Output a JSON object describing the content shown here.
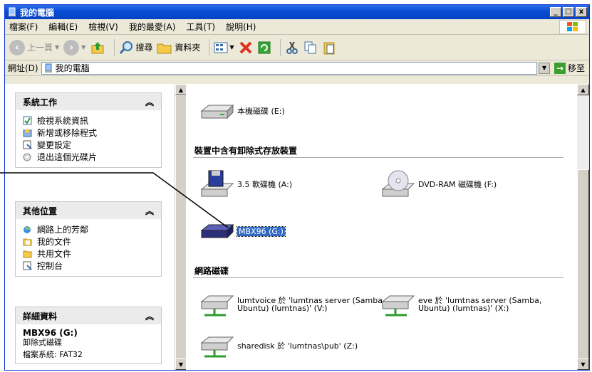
{
  "window": {
    "title": "我的電腦",
    "min_label": "_",
    "max_label": "□",
    "close_label": "x"
  },
  "menu": [
    "檔案(F)",
    "編輯(E)",
    "檢視(V)",
    "我的最愛(A)",
    "工具(T)",
    "說明(H)"
  ],
  "toolbar": {
    "back": "上一頁",
    "search": "搜尋",
    "folders": "資料夾"
  },
  "address": {
    "label": "網址(D)",
    "value": "我的電腦",
    "go": "移至"
  },
  "left": {
    "tasks": {
      "title": "系統工作",
      "items": [
        "檢視系統資訊",
        "新增或移除程式",
        "變更設定",
        "退出這個光碟片"
      ]
    },
    "places": {
      "title": "其他位置",
      "items": [
        "網路上的芳鄰",
        "我的文件",
        "共用文件",
        "控制台"
      ]
    },
    "details": {
      "title": "詳細資料",
      "name": "MBX96 (G:)",
      "type": "卸除式磁碟",
      "fs": "檔案系統: FAT32"
    }
  },
  "main": {
    "local_drive": "本機磁碟 (E:)",
    "removable_group": "裝置中含有卸除式存放裝置",
    "removable": [
      "3.5 軟碟機 (A:)",
      "DVD-RAM 磁碟機 (F:)",
      "MBX96 (G:)"
    ],
    "network_group": "網路磁碟",
    "network": [
      {
        "l1": "lumtvoice 於 'lumtnas server (Samba,",
        "l2": "Ubuntu) (lumtnas)' (V:)"
      },
      {
        "l1": "eve 於 'lumtnas server (Samba,",
        "l2": "Ubuntu) (lumtnas)' (X:)"
      },
      {
        "l1": "sharedisk 於 'lumtnas\\pub' (Z:)",
        "l2": ""
      }
    ]
  },
  "colors": {
    "titlebar": "#0a4fd6",
    "selection": "#316ac5"
  }
}
